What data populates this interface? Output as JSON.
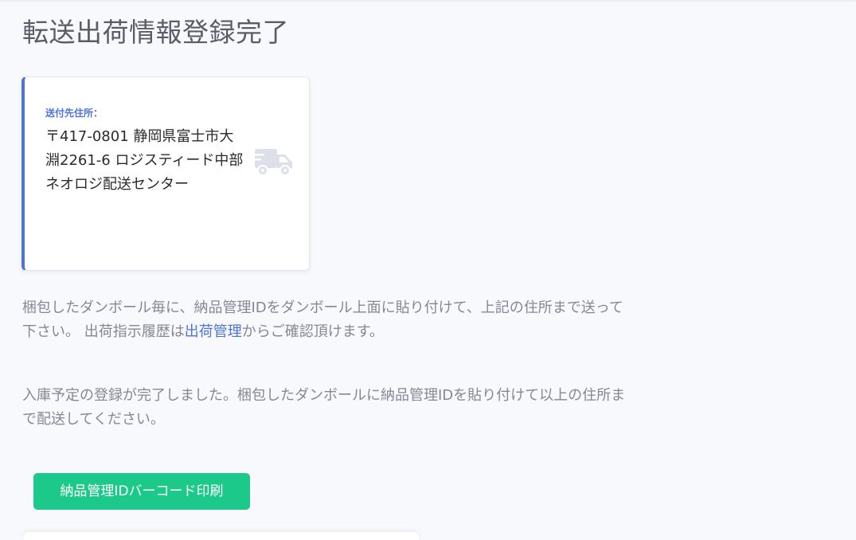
{
  "page": {
    "title": "転送出荷情報登録完了"
  },
  "address_card": {
    "label": "送付先住所：",
    "address": "〒417-0801 静岡県富士市大淵2261-6 ロジスティード中部 ネオロジ配送センター",
    "icon": "truck-icon",
    "accent_color": "#4e73df"
  },
  "instructions": {
    "para1_before": "梱包したダンボール毎に、納品管理IDをダンボール上面に貼り付けて、上記の住所まで送って下さい。 出荷指示履歴は",
    "para1_link": "出荷管理",
    "para1_after": "からご確認頂けます。",
    "para2": "入庫予定の登録が完了しました。梱包したダンボールに納品管理IDを貼り付けて以上の住所まで配送してください。"
  },
  "actions": {
    "print_label": "納品管理IDバーコード印刷",
    "button_color": "#1cc88a"
  }
}
